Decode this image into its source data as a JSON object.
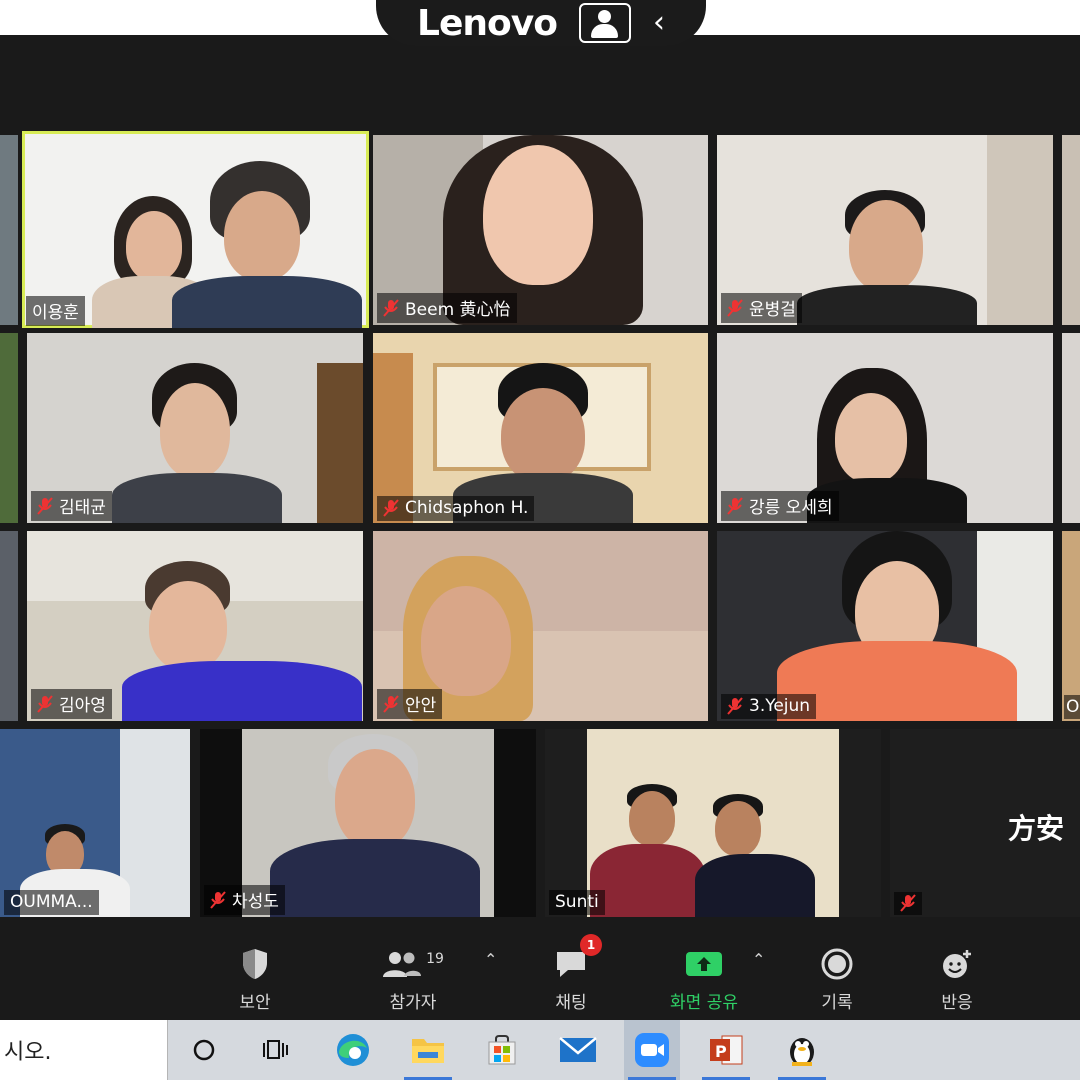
{
  "laptop_bar": {
    "brand": "Lenovo"
  },
  "participants": [
    {
      "name": "이용훈",
      "muted": false
    },
    {
      "name": "Beem 黄心怡",
      "muted": true
    },
    {
      "name": "윤병걸",
      "muted": true
    },
    {
      "name": "김태균",
      "muted": true
    },
    {
      "name": "Chidsaphon H.",
      "muted": true
    },
    {
      "name": "강릉 오세희",
      "muted": true
    },
    {
      "name": "김아영",
      "muted": true
    },
    {
      "name": "안안",
      "muted": true
    },
    {
      "name": "3.Yejun",
      "muted": true
    },
    {
      "name": "OUMMA...",
      "muted": false
    },
    {
      "name": "차성도",
      "muted": true
    },
    {
      "name": "Sunti",
      "muted": false
    },
    {
      "name": "方安",
      "muted": true
    }
  ],
  "partial_tile_label": "O",
  "toolbar": {
    "security": "보안",
    "participants": "참가자",
    "participant_count": "19",
    "chat": "채팅",
    "chat_badge": "1",
    "share_screen": "화면 공유",
    "record": "기록",
    "reactions": "반응"
  },
  "taskbar": {
    "search_text": "시오."
  },
  "colors": {
    "active_speaker_border": "#d8ec56",
    "share_green": "#2fd066",
    "badge_red": "#e02828"
  }
}
